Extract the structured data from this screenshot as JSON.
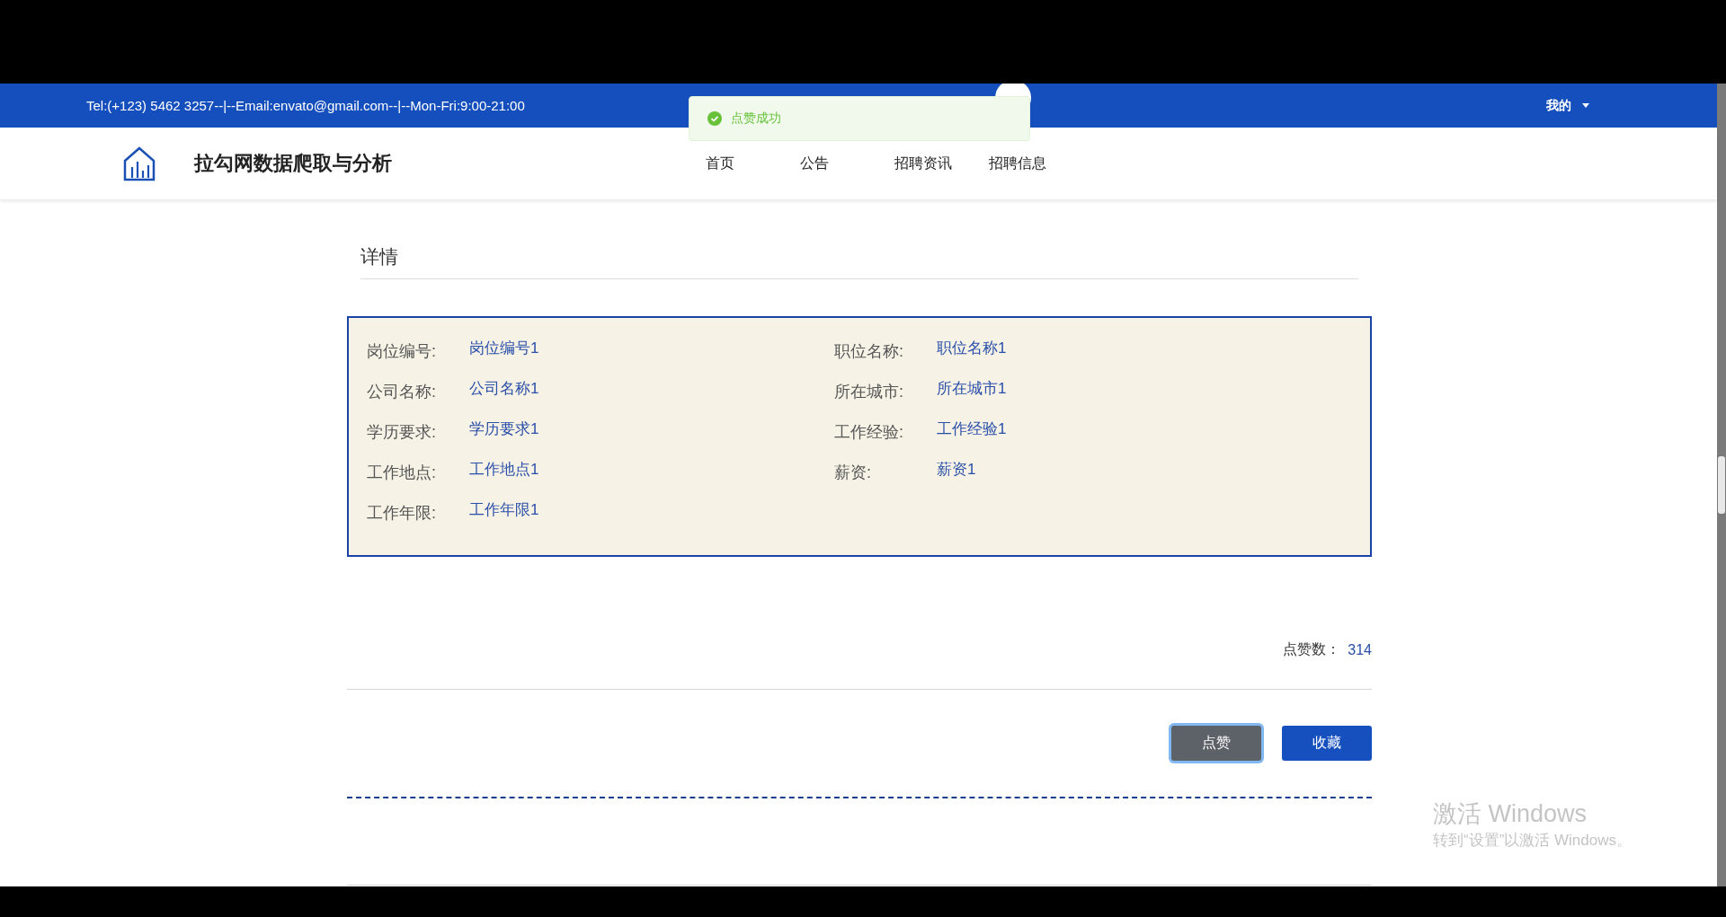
{
  "top_bar": {
    "contact": "Tel:(+123) 5462 3257--|--Email:envato@gmail.com--|--Mon-Fri:9:00-21:00",
    "user_menu": "我的"
  },
  "toast": {
    "message": "点赞成功"
  },
  "header": {
    "site_title": "拉勾网数据爬取与分析",
    "nav": [
      {
        "label": "首页"
      },
      {
        "label": "公告"
      },
      {
        "label": "招聘资讯"
      },
      {
        "label": "招聘信息"
      }
    ]
  },
  "detail": {
    "title": "详情",
    "fields": [
      {
        "label": "岗位编号:",
        "value": "岗位编号1"
      },
      {
        "label": "职位名称:",
        "value": "职位名称1"
      },
      {
        "label": "公司名称:",
        "value": "公司名称1"
      },
      {
        "label": "所在城市:",
        "value": "所在城市1"
      },
      {
        "label": "学历要求:",
        "value": "学历要求1"
      },
      {
        "label": "工作经验:",
        "value": "工作经验1"
      },
      {
        "label": "工作地点:",
        "value": "工作地点1"
      },
      {
        "label": "薪资:",
        "value": "薪资1"
      },
      {
        "label": "工作年限:",
        "value": "工作年限1"
      }
    ],
    "likes_label": "点赞数：",
    "likes_value": "314",
    "buttons": [
      {
        "label": "点赞",
        "kind": "secondary",
        "focused": true
      },
      {
        "label": "收藏",
        "kind": "primary",
        "focused": false
      }
    ]
  },
  "activation_notice": {
    "title": "激活 Windows",
    "subtitle": "转到“设置”以激活 Windows。"
  }
}
